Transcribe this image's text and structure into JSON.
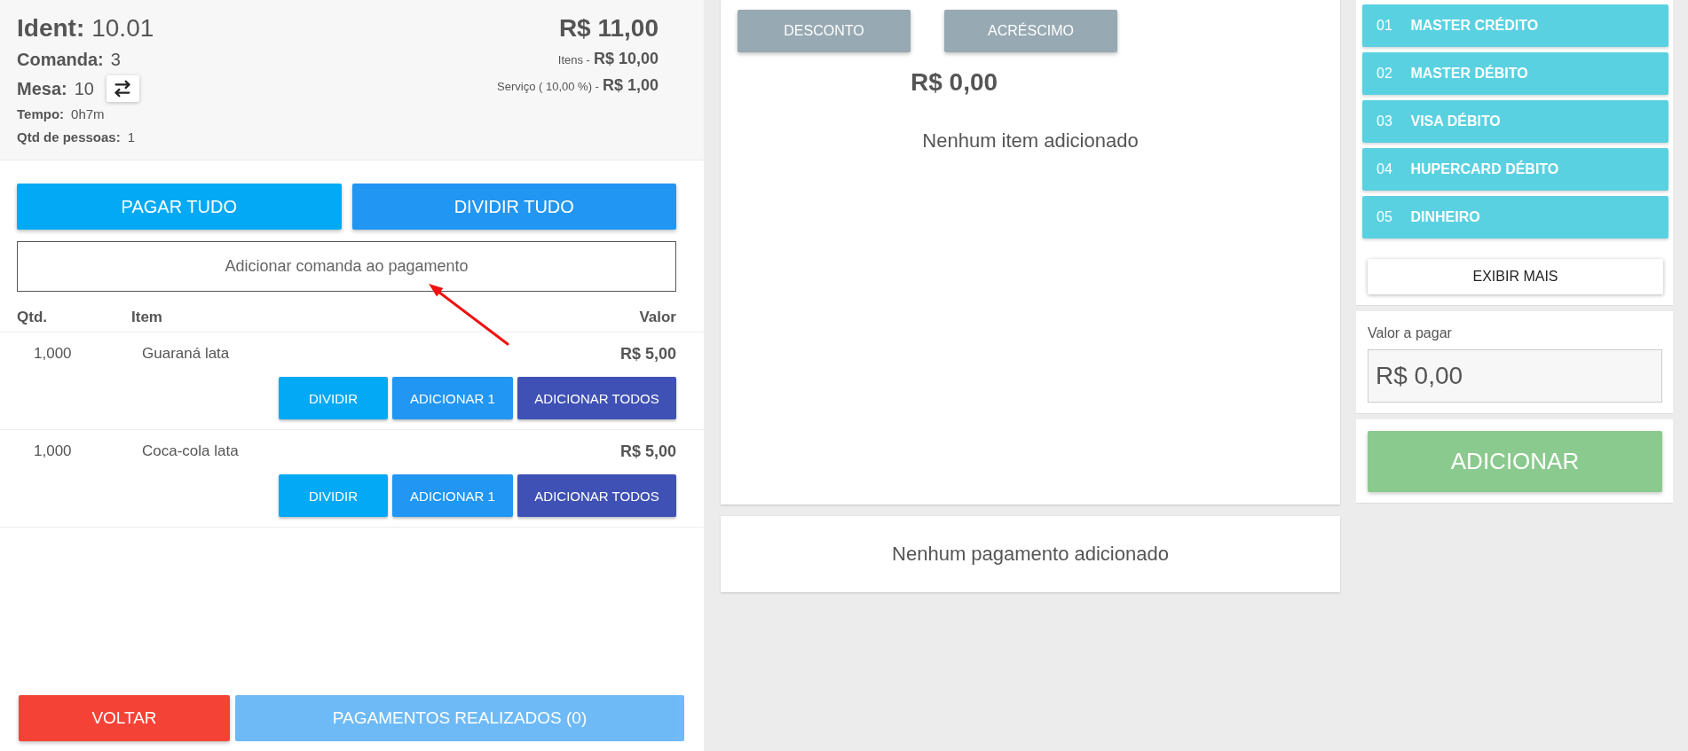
{
  "header": {
    "ident": {
      "label": "Ident:",
      "value": "10.01"
    },
    "comanda": {
      "label": "Comanda:",
      "value": "3"
    },
    "mesa": {
      "label": "Mesa:",
      "value": "10"
    },
    "tempo": {
      "label": "Tempo:",
      "value": "0h7m"
    },
    "pessoas": {
      "label": "Qtd de pessoas:",
      "value": "1"
    },
    "total": "R$ 11,00",
    "itens": {
      "label": "Itens -",
      "value": "R$ 10,00"
    },
    "servico": {
      "label": "Serviço ( 10,00 %) -",
      "value": "R$ 1,00"
    }
  },
  "actions": [
    {
      "label": "PAGAR TUDO",
      "kind": "pay"
    },
    {
      "label": "DIVIDIR TUDO",
      "kind": "split"
    }
  ],
  "add_comanda": {
    "label": "Adicionar comanda ao pagamento"
  },
  "table": {
    "columns": [
      "Qtd.",
      "Item",
      "Valor"
    ],
    "rows": [
      {
        "qtd": "1,000",
        "item": "Guaraná lata",
        "valor": "R$ 5,00",
        "buttons": [
          {
            "label": "DIVIDIR",
            "kind": "split"
          },
          {
            "label": "ADICIONAR 1",
            "kind": "add_one"
          },
          {
            "label": "ADICIONAR TODOS",
            "kind": "add_all"
          }
        ]
      },
      {
        "qtd": "1,000",
        "item": "Coca-cola lata",
        "valor": "R$ 5,00",
        "buttons": [
          {
            "label": "DIVIDIR",
            "kind": "split"
          },
          {
            "label": "ADICIONAR 1",
            "kind": "add_one"
          },
          {
            "label": "ADICIONAR TODOS",
            "kind": "add_all"
          }
        ]
      }
    ]
  },
  "footer": [
    {
      "label": "VOLTAR",
      "kind": "back",
      "disabled": false
    },
    {
      "label": "PAGAMENTOS REALIZADOS (0)",
      "kind": "payments",
      "disabled": true
    }
  ],
  "adjustments": {
    "buttons": [
      "DESCONTO",
      "ACRÉSCIMO"
    ],
    "amount": "R$ 0,00",
    "empty_message": "Nenhum item adicionado"
  },
  "payments": {
    "empty_message": "Nenhum pagamento adicionado"
  },
  "payment_methods": [
    {
      "code": "01",
      "name": "MASTER CRÉDITO"
    },
    {
      "code": "02",
      "name": "MASTER DÉBITO"
    },
    {
      "code": "03",
      "name": "VISA DÉBITO"
    },
    {
      "code": "04",
      "name": "HUPERCARD DÉBITO"
    },
    {
      "code": "05",
      "name": "DINHEIRO"
    }
  ],
  "show_more": "EXIBIR MAIS",
  "amount_due": {
    "label": "Valor a pagar",
    "value": "R$ 0,00"
  },
  "submit": "ADICIONAR"
}
